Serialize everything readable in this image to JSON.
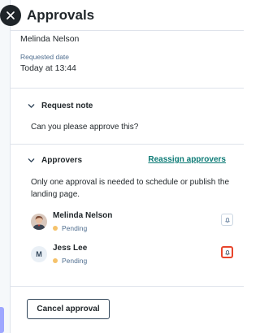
{
  "header": {
    "title": "Approvals"
  },
  "request": {
    "requester": "Melinda Nelson",
    "date_label": "Requested date",
    "date_value": "Today at 13:44"
  },
  "request_note": {
    "heading": "Request note",
    "text": "Can you please approve this?"
  },
  "approvers": {
    "heading": "Approvers",
    "reassign_label": "Reassign approvers",
    "note": "Only one approval is needed to schedule or publish the landing page.",
    "items": [
      {
        "name": "Melinda Nelson",
        "status": "Pending",
        "avatar": "photo"
      },
      {
        "name": "Jess Lee",
        "status": "Pending",
        "avatar_initial": "M"
      }
    ]
  },
  "footer": {
    "cancel_label": "Cancel approval"
  },
  "colors": {
    "accent_link": "#0b7a75",
    "pending": "#f5c26b",
    "focus_ring": "#e8452c"
  },
  "icons": {
    "close": "close-icon",
    "chevron": "chevron-down-icon",
    "bell": "bell-icon"
  }
}
